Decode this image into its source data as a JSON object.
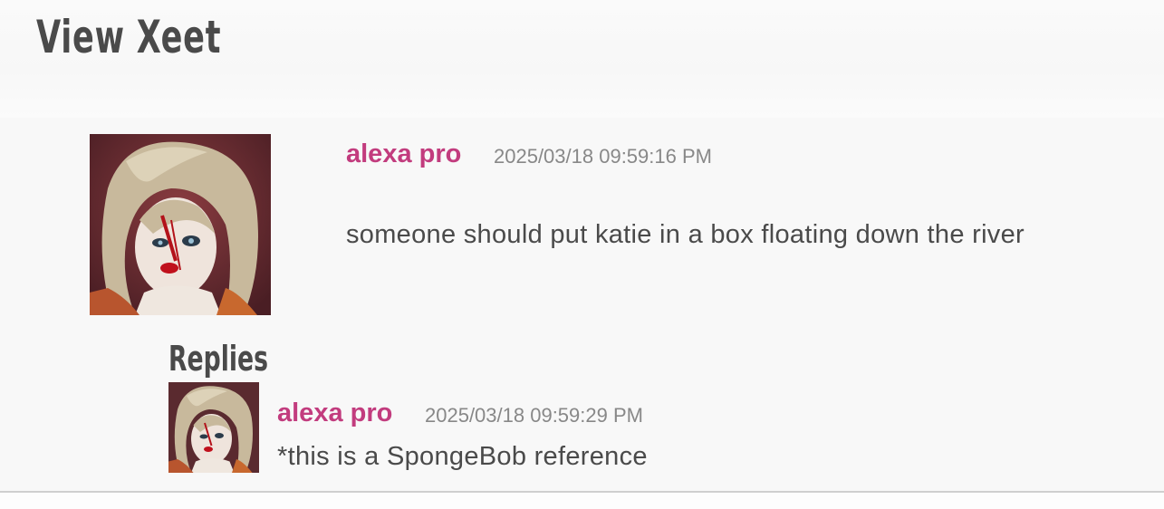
{
  "page": {
    "title": "View Xeet"
  },
  "xeet": {
    "avatar_icon": "user-avatar-image",
    "username": "alexa pro",
    "timestamp": "2025/03/18 09:59:16 PM",
    "text": "someone should put katie in a box floating down the river"
  },
  "replies": {
    "heading": "Replies",
    "items": [
      {
        "avatar_icon": "user-avatar-image",
        "username": "alexa pro",
        "timestamp": "2025/03/18 09:59:29 PM",
        "text": "*this is a SpongeBob reference"
      }
    ]
  },
  "colors": {
    "username": "#c23c7e",
    "text": "#4a4a4a",
    "timestamp": "#888888",
    "panel_bg": "#f8f8f8"
  }
}
